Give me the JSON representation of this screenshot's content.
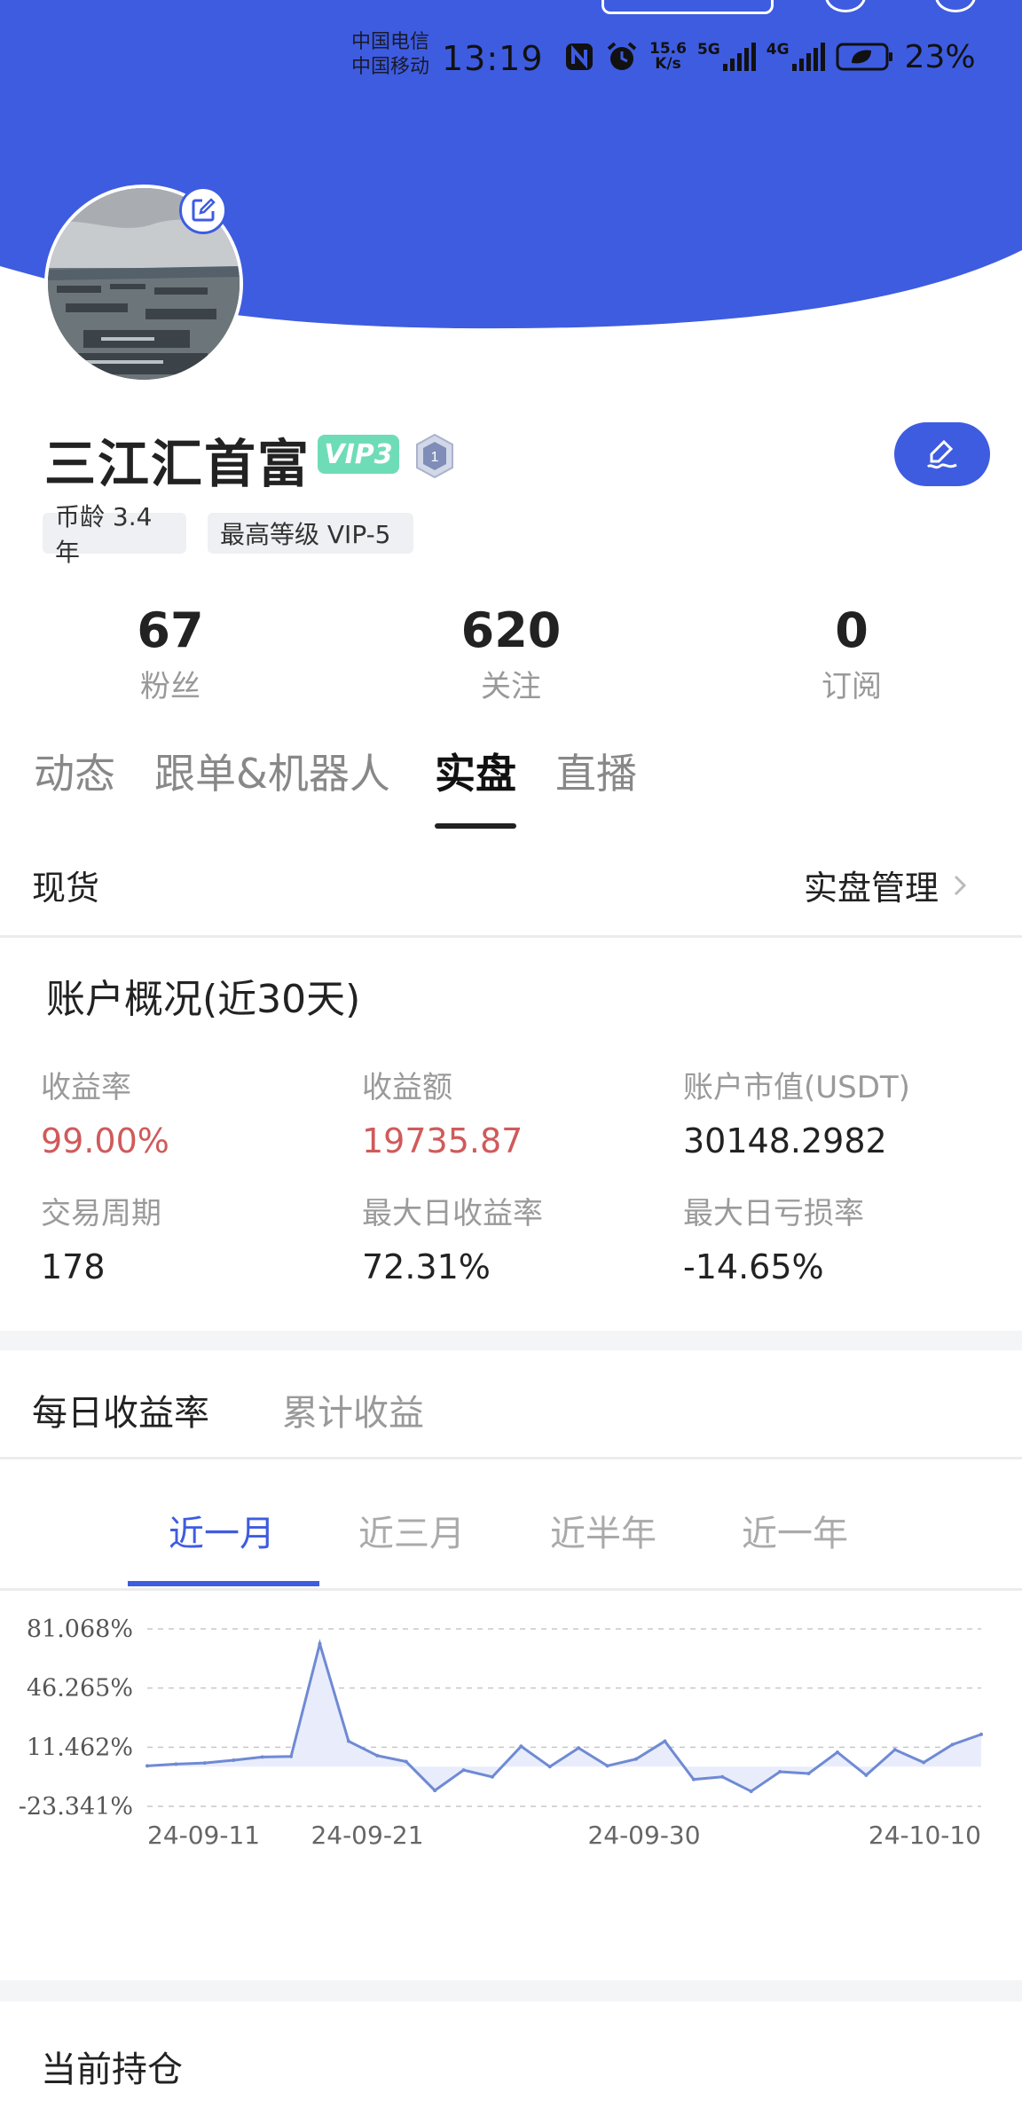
{
  "colors": {
    "brand_blue": "#3e5ce0",
    "vip_green": "#6fdcb8",
    "profit_red": "#d05a5a"
  },
  "status_bar": {
    "carrier_1": "中国电信",
    "carrier_2": "中国移动",
    "time": "13:19",
    "net_speed_top": "15.6",
    "net_speed_bottom": "K/s",
    "net_5g": "5G",
    "net_4g": "4G",
    "battery": "23%",
    "icons": [
      "nfc-icon",
      "alarm-icon",
      "signal-icon",
      "battery-icon"
    ]
  },
  "profile": {
    "username": "三江汇首富",
    "vip_badge": "VIP3",
    "level_badge": "1",
    "tags": [
      "币龄 3.4年",
      "最高等级 VIP-5"
    ],
    "stats": [
      {
        "value": "67",
        "label": "粉丝"
      },
      {
        "value": "620",
        "label": "关注"
      },
      {
        "value": "0",
        "label": "订阅"
      }
    ]
  },
  "tabs": {
    "items": [
      "动态",
      "跟单&机器人",
      "实盘",
      "直播"
    ],
    "active": "实盘"
  },
  "spot": {
    "title": "现货",
    "manage_link": "实盘管理"
  },
  "overview": {
    "title": "账户概况(近30天)",
    "metrics": [
      {
        "label": "收益率",
        "value": "99.00%"
      },
      {
        "label": "收益额",
        "value": "19735.87"
      },
      {
        "label": "账户市值(USDT)",
        "value": "30148.2982"
      },
      {
        "label": "交易周期",
        "value": "178"
      },
      {
        "label": "最大日收益率",
        "value": "72.31%"
      },
      {
        "label": "最大日亏损率",
        "value": "-14.65%"
      }
    ]
  },
  "performance_tabs": {
    "items": [
      "每日收益率",
      "累计收益"
    ],
    "active": "每日收益率"
  },
  "range_tabs": {
    "items": [
      "近一月",
      "近三月",
      "近半年",
      "近一年"
    ],
    "active": "近一月"
  },
  "chart_data": {
    "type": "area",
    "yticks": [
      "81.068%",
      "46.265%",
      "11.462%",
      "-23.341%"
    ],
    "ytick_values": [
      81.068,
      46.265,
      11.462,
      -23.341
    ],
    "ylim": [
      -23.341,
      81.068
    ],
    "xticks": [
      "24-09-11",
      "24-09-21",
      "24-09-30",
      "24-10-10"
    ],
    "grid": true,
    "baseline": 0,
    "values": [
      0.5,
      1.5,
      2.2,
      3.8,
      5.7,
      6.0,
      72.3,
      15.0,
      6.5,
      3.0,
      -14.0,
      -2.0,
      -6.0,
      12.0,
      0.0,
      11.0,
      0.5,
      4.5,
      15.0,
      -7.5,
      -6.0,
      -14.5,
      -3.0,
      -4.0,
      8.5,
      -5.0,
      10.0,
      2.5,
      13.0,
      19.0
    ]
  },
  "holdings": {
    "title": "当前持仓"
  }
}
